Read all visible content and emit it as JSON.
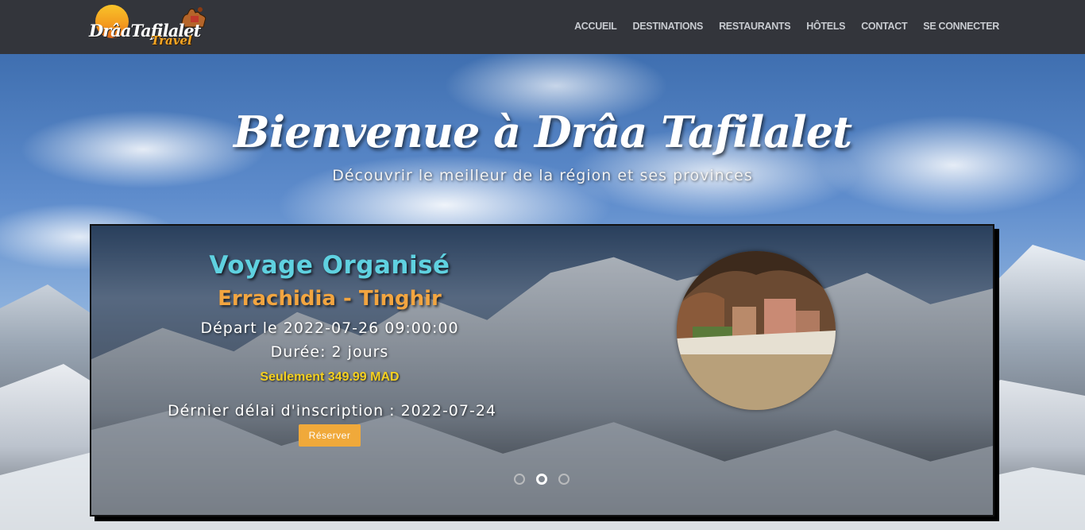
{
  "brand": {
    "logo_line1": "DrâaTafilalet",
    "logo_line2": "Travel"
  },
  "nav": {
    "items": [
      {
        "label": "ACCUEIL"
      },
      {
        "label": "DESTINATIONS"
      },
      {
        "label": "RESTAURANTS"
      },
      {
        "label": "HÔTELS"
      },
      {
        "label": "CONTACT"
      },
      {
        "label": "SE CONNECTER"
      }
    ]
  },
  "hero": {
    "title": "Bienvenue à Drâa Tafilalet",
    "subtitle": "Découvrir le meilleur de la région et ses provinces"
  },
  "slide": {
    "title": "Voyage Organisé",
    "route": "Errachidia - Tinghir",
    "depart": "Départ le 2022-07-26 09:00:00",
    "duree": "Durée: 2 jours",
    "price": "Seulement 349.99 MAD",
    "deadline": "Dérnier délai d'inscription : 2022-07-24",
    "button": "Réserver"
  },
  "carousel": {
    "total": 3,
    "active_index": 2
  },
  "colors": {
    "navbar_bg": "#33353b",
    "nav_text": "#c8cbd0",
    "slide_title": "#5fd1e0",
    "slide_route": "#f2a540",
    "price": "#f5d020",
    "button": "#f0a93a"
  },
  "icons": {
    "logo_sun": "sun-icon",
    "logo_camel": "camel-icon"
  }
}
